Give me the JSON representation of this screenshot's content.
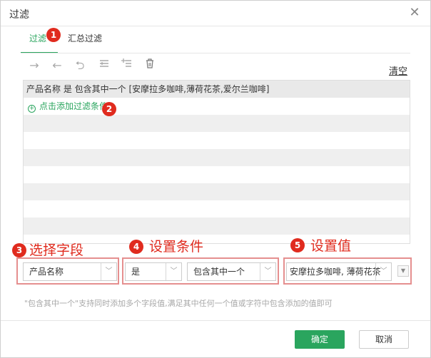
{
  "dialog": {
    "title": "过滤",
    "close_icon": "close-icon"
  },
  "tabs": [
    {
      "label": "过滤",
      "active": true
    },
    {
      "label": "汇总过滤",
      "active": false
    }
  ],
  "toolbar": {
    "icons": [
      "arrow-right-icon",
      "arrow-left-icon",
      "return-icon",
      "insert-row-icon",
      "add-row-icon",
      "trash-icon"
    ],
    "clear_label": "清空"
  },
  "grid": {
    "header_row": "产品名称 是 包含其中一个 [安摩拉多咖啡,薄荷花茶,爱尔兰咖啡]",
    "add_label": "点击添加过滤条件"
  },
  "markers": {
    "m1": "1",
    "m2": "2",
    "m3": "3",
    "m4": "4",
    "m5": "5"
  },
  "sections": {
    "field_label": "选择字段",
    "condition_label": "设置条件",
    "value_label": "设置值"
  },
  "selects": {
    "field": "产品名称",
    "is": "是",
    "condition": "包含其中一个",
    "value": "安摩拉多咖啡, 薄荷花茶"
  },
  "hint": "\"包含其中一个\"支持同时添加多个字段值,满足其中任何一个值或字符中包含添加的值即可",
  "footer": {
    "ok_label": "确定",
    "cancel_label": "取消"
  },
  "colors": {
    "accent": "#2aa55e",
    "marker": "#e02b1e",
    "highlight_box": "#e58f8f"
  }
}
